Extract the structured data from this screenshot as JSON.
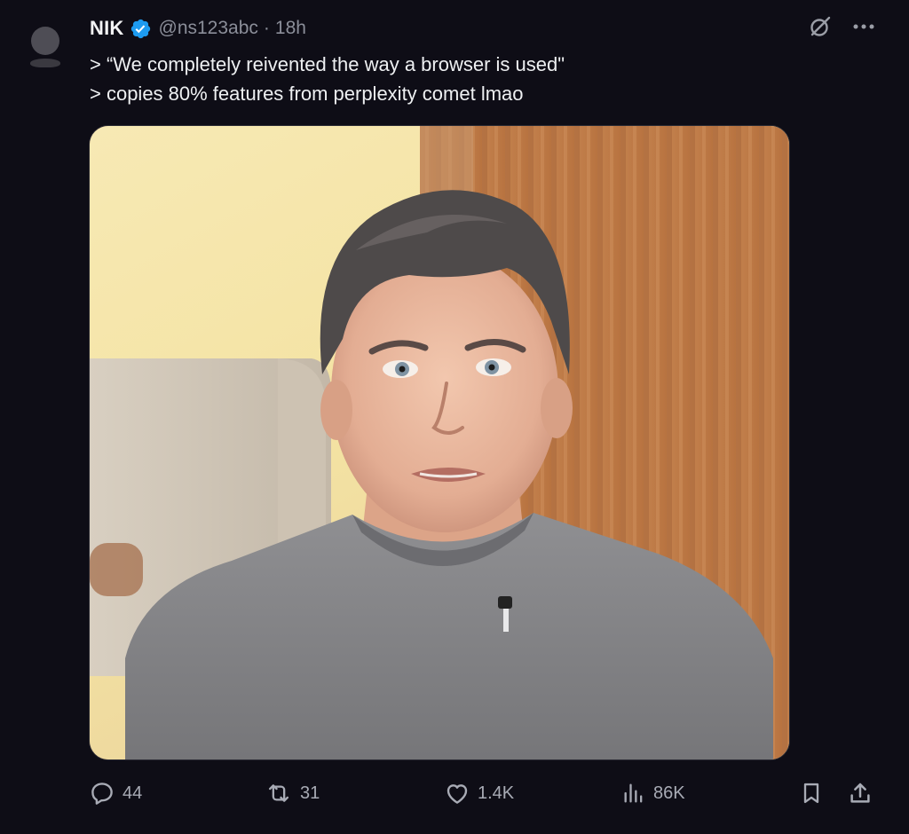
{
  "tweet": {
    "author_name": "NIK",
    "handle": "@ns123abc",
    "separator": "·",
    "time": "18h",
    "lines": [
      "> “We completely reivented the way a browser is used\"",
      "> copies 80% features from perplexity comet lmao"
    ]
  },
  "actions": {
    "replies": "44",
    "reposts": "31",
    "likes": "1.4K",
    "views": "86K"
  },
  "icons": {
    "verified": "verified-badge-icon",
    "grok": "grok-icon",
    "more": "more-icon",
    "reply": "reply-icon",
    "repost": "repost-icon",
    "like": "heart-icon",
    "views": "views-icon",
    "bookmark": "bookmark-icon",
    "share": "share-icon"
  },
  "colors": {
    "background": "#0e0d16",
    "verified": "#1d9bf0",
    "muted": "#8b8e99"
  }
}
